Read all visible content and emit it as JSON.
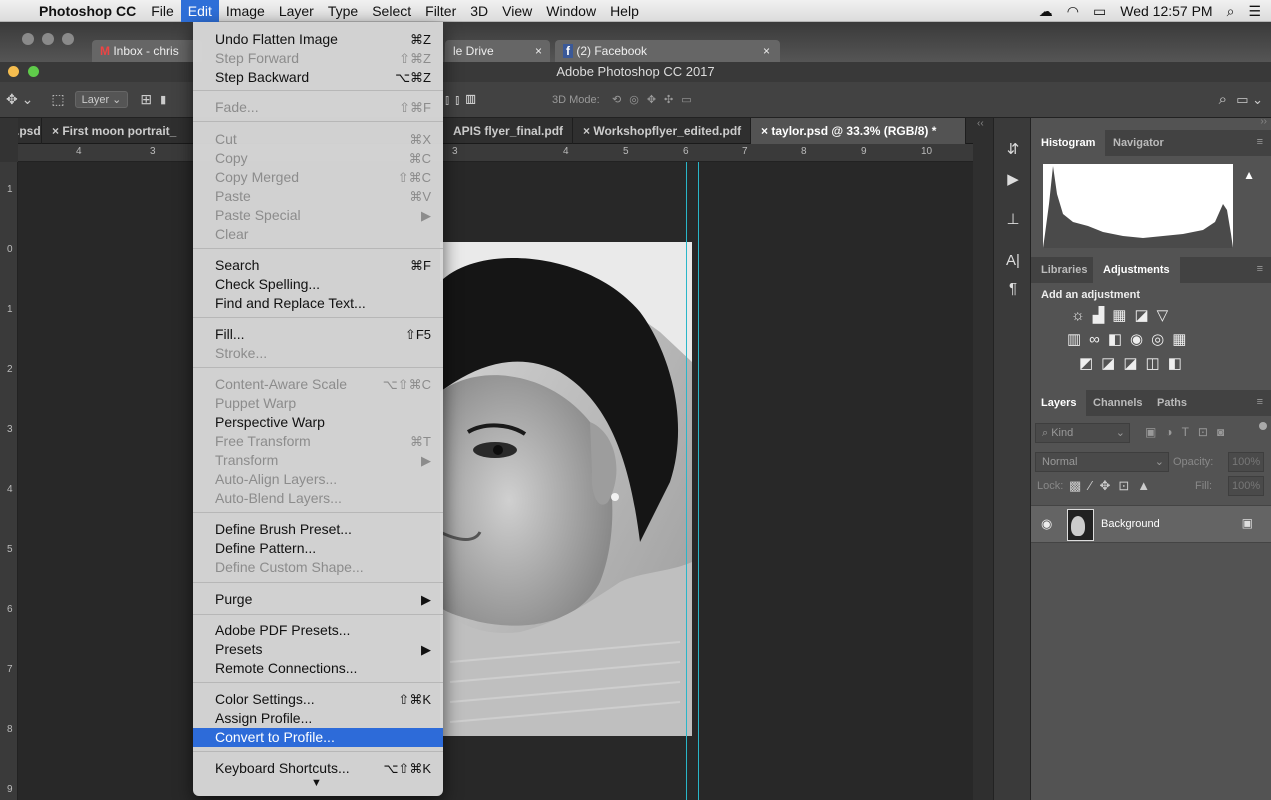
{
  "menubar": {
    "app_name": "Photoshop CC",
    "items": [
      "File",
      "Edit",
      "Image",
      "Layer",
      "Type",
      "Select",
      "Filter",
      "3D",
      "View",
      "Window",
      "Help"
    ],
    "clock": "Wed 12:57 PM"
  },
  "browser_tabs": [
    "Inbox - chris",
    "le Drive",
    "(2) Facebook"
  ],
  "window_title": "Adobe Photoshop CC 2017",
  "options_bar": {
    "layer_select": "Layer",
    "mode_label": "3D Mode:"
  },
  "doc_tabs": [
    ".psd",
    "First moon portrait_",
    "APIS flyer_final.pdf",
    "Workshopflyer_edited.pdf",
    "taylor.psd @ 33.3% (RGB/8) *"
  ],
  "ruler": {
    "h": [
      "4",
      "3",
      "3",
      "4",
      "5",
      "6",
      "7",
      "8",
      "9",
      "10"
    ],
    "v": [
      "1",
      "0",
      "1",
      "2",
      "3",
      "4",
      "5",
      "6",
      "7",
      "8",
      "9"
    ]
  },
  "panels": {
    "histogram_tabs": [
      "Histogram",
      "Navigator"
    ],
    "adjust_tabs": [
      "Libraries",
      "Adjustments"
    ],
    "add_adjustment": "Add an adjustment",
    "layers_tabs": [
      "Layers",
      "Channels",
      "Paths"
    ],
    "kind": "Kind",
    "blend_mode": "Normal",
    "opacity_label": "Opacity:",
    "opacity_value": "100%",
    "lock_label": "Lock:",
    "fill_label": "Fill:",
    "fill_value": "100%",
    "layer_name": "Background"
  },
  "edit_menu": {
    "items": [
      {
        "label": "Undo Flatten Image",
        "shortcut": "⌘Z"
      },
      {
        "label": "Step Forward",
        "shortcut": "⇧⌘Z"
      },
      {
        "label": "Step Backward",
        "shortcut": "⌥⌘Z"
      },
      {
        "label": "Fade...",
        "shortcut": "⇧⌘F"
      },
      {
        "label": "Cut",
        "shortcut": "⌘X"
      },
      {
        "label": "Copy",
        "shortcut": "⌘C"
      },
      {
        "label": "Copy Merged",
        "shortcut": "⇧⌘C"
      },
      {
        "label": "Paste",
        "shortcut": "⌘V"
      },
      {
        "label": "Paste Special",
        "shortcut": "▶"
      },
      {
        "label": "Clear",
        "shortcut": ""
      },
      {
        "label": "Search",
        "shortcut": "⌘F"
      },
      {
        "label": "Check Spelling...",
        "shortcut": ""
      },
      {
        "label": "Find and Replace Text...",
        "shortcut": ""
      },
      {
        "label": "Fill...",
        "shortcut": "⇧F5"
      },
      {
        "label": "Stroke...",
        "shortcut": ""
      },
      {
        "label": "Content-Aware Scale",
        "shortcut": "⌥⇧⌘C"
      },
      {
        "label": "Puppet Warp",
        "shortcut": ""
      },
      {
        "label": "Perspective Warp",
        "shortcut": ""
      },
      {
        "label": "Free Transform",
        "shortcut": "⌘T"
      },
      {
        "label": "Transform",
        "shortcut": "▶"
      },
      {
        "label": "Auto-Align Layers...",
        "shortcut": ""
      },
      {
        "label": "Auto-Blend Layers...",
        "shortcut": ""
      },
      {
        "label": "Define Brush Preset...",
        "shortcut": ""
      },
      {
        "label": "Define Pattern...",
        "shortcut": ""
      },
      {
        "label": "Define Custom Shape...",
        "shortcut": ""
      },
      {
        "label": "Purge",
        "shortcut": "▶"
      },
      {
        "label": "Adobe PDF Presets...",
        "shortcut": ""
      },
      {
        "label": "Presets",
        "shortcut": "▶"
      },
      {
        "label": "Remote Connections...",
        "shortcut": ""
      },
      {
        "label": "Color Settings...",
        "shortcut": "⇧⌘K"
      },
      {
        "label": "Assign Profile...",
        "shortcut": ""
      },
      {
        "label": "Convert to Profile...",
        "shortcut": ""
      },
      {
        "label": "Keyboard Shortcuts...",
        "shortcut": "⌥⇧⌘K"
      }
    ],
    "more_arrow": "▼"
  }
}
